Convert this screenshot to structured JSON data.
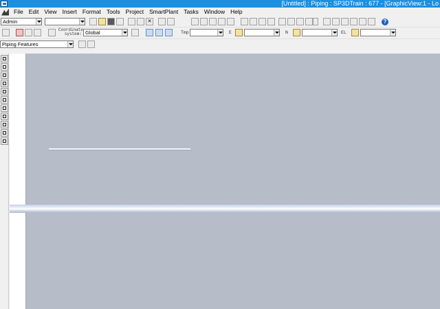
{
  "window": {
    "title": "[Untitled] : Piping : SP3DTrain : 677 - [GraphicView:1 - Lo"
  },
  "menubar": {
    "items": [
      "File",
      "Edit",
      "View",
      "Insert",
      "Format",
      "Tools",
      "Project",
      "SmartPlant",
      "Tasks",
      "Window",
      "Help"
    ]
  },
  "toolbar1": {
    "permission_group": "Admin",
    "second_combo": "",
    "help_label": "?"
  },
  "toolbar2": {
    "coordinate_label_line1": "Coordinate",
    "coordinate_label_line2": "system:",
    "coordinate_system_value": "Global",
    "field_e_label": "E",
    "field_e_value": "",
    "field_n_label": "N",
    "field_n_value": "",
    "field_el_label": "EL",
    "field_el_value": "",
    "field_tmp_label": "Tmp",
    "field_tmp_value": "",
    "field_last_value": ""
  },
  "toolbar3": {
    "locate_filter": "Piping Features"
  },
  "colors": {
    "titlebar": "#1b8fe0",
    "graphic_background": "#b6bcc8",
    "pipe_highlight": "#ffffff"
  },
  "palette": {
    "icons": [
      "select-icon",
      "route-pipe-icon",
      "insert-component-icon",
      "insert-tap-icon",
      "insert-split-icon",
      "insert-specialty-icon",
      "route-slope-icon",
      "insert-support-icon",
      "insert-flange-icon",
      "connect-icon",
      "measure-icon"
    ]
  }
}
